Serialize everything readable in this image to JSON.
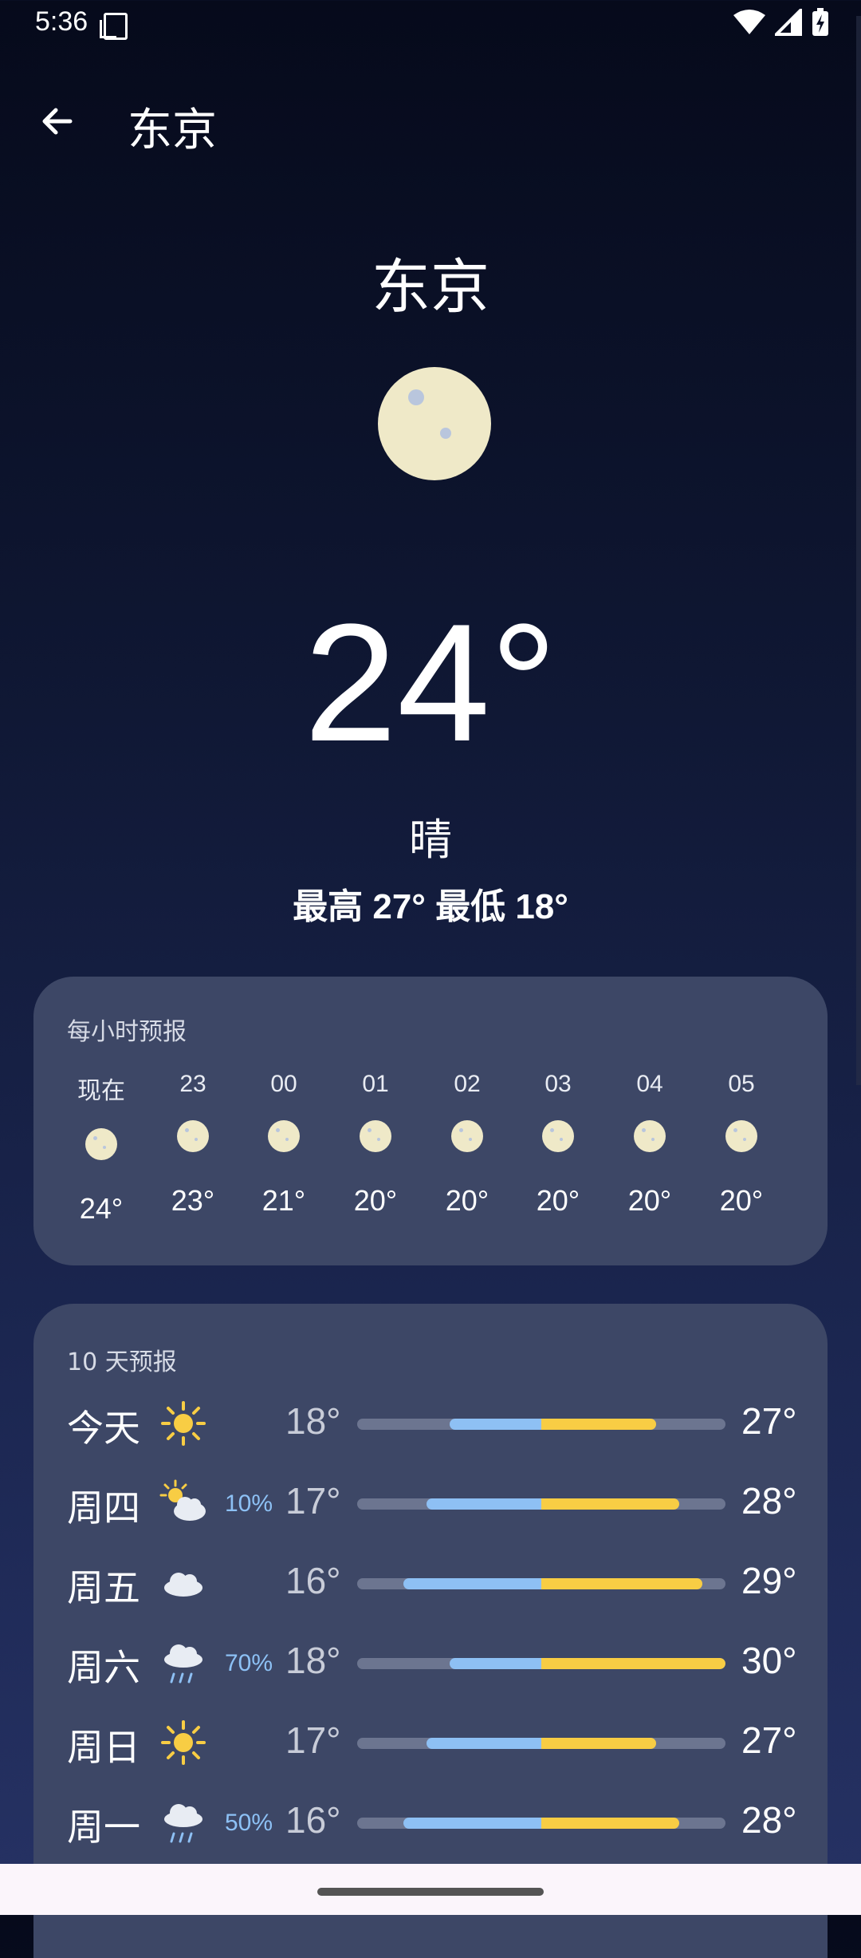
{
  "status_bar": {
    "time": "5:36"
  },
  "app_bar": {
    "title": "东京"
  },
  "current": {
    "city": "东京",
    "temp": "24°",
    "condition": "晴",
    "hi_lo": "最高 27° 最低 18°"
  },
  "hourly": {
    "title": "每小时预报",
    "items": [
      {
        "time": "现在",
        "temp": "24°",
        "icon": "moon-icon"
      },
      {
        "time": "23",
        "temp": "23°",
        "icon": "moon-icon"
      },
      {
        "time": "00",
        "temp": "21°",
        "icon": "moon-icon"
      },
      {
        "time": "01",
        "temp": "20°",
        "icon": "moon-icon"
      },
      {
        "time": "02",
        "temp": "20°",
        "icon": "moon-icon"
      },
      {
        "time": "03",
        "temp": "20°",
        "icon": "moon-icon"
      },
      {
        "time": "04",
        "temp": "20°",
        "icon": "moon-icon"
      },
      {
        "time": "05",
        "temp": "20°",
        "icon": "moon-icon"
      }
    ]
  },
  "daily": {
    "title": "10 天预报",
    "items": [
      {
        "day": "今天",
        "icon": "sun-icon",
        "precip": "",
        "low": "18°",
        "high": "27°",
        "low_val": 18,
        "high_val": 27
      },
      {
        "day": "周四",
        "icon": "sun-cloud-icon",
        "precip": "10%",
        "low": "17°",
        "high": "28°",
        "low_val": 17,
        "high_val": 28
      },
      {
        "day": "周五",
        "icon": "cloud-icon",
        "precip": "",
        "low": "16°",
        "high": "29°",
        "low_val": 16,
        "high_val": 29
      },
      {
        "day": "周六",
        "icon": "rain-icon",
        "precip": "70%",
        "low": "18°",
        "high": "30°",
        "low_val": 18,
        "high_val": 30
      },
      {
        "day": "周日",
        "icon": "sun-icon",
        "precip": "",
        "low": "17°",
        "high": "27°",
        "low_val": 17,
        "high_val": 27
      },
      {
        "day": "周一",
        "icon": "rain-icon",
        "precip": "50%",
        "low": "16°",
        "high": "28°",
        "low_val": 16,
        "high_val": 28
      }
    ],
    "range_min": 14,
    "range_max": 30,
    "mid_point": 22
  },
  "colors": {
    "cold_bar": "#8ec0f4",
    "warm_bar": "#f8cd44",
    "card_bg": "#3d4766",
    "moon": "#efe9c8"
  }
}
